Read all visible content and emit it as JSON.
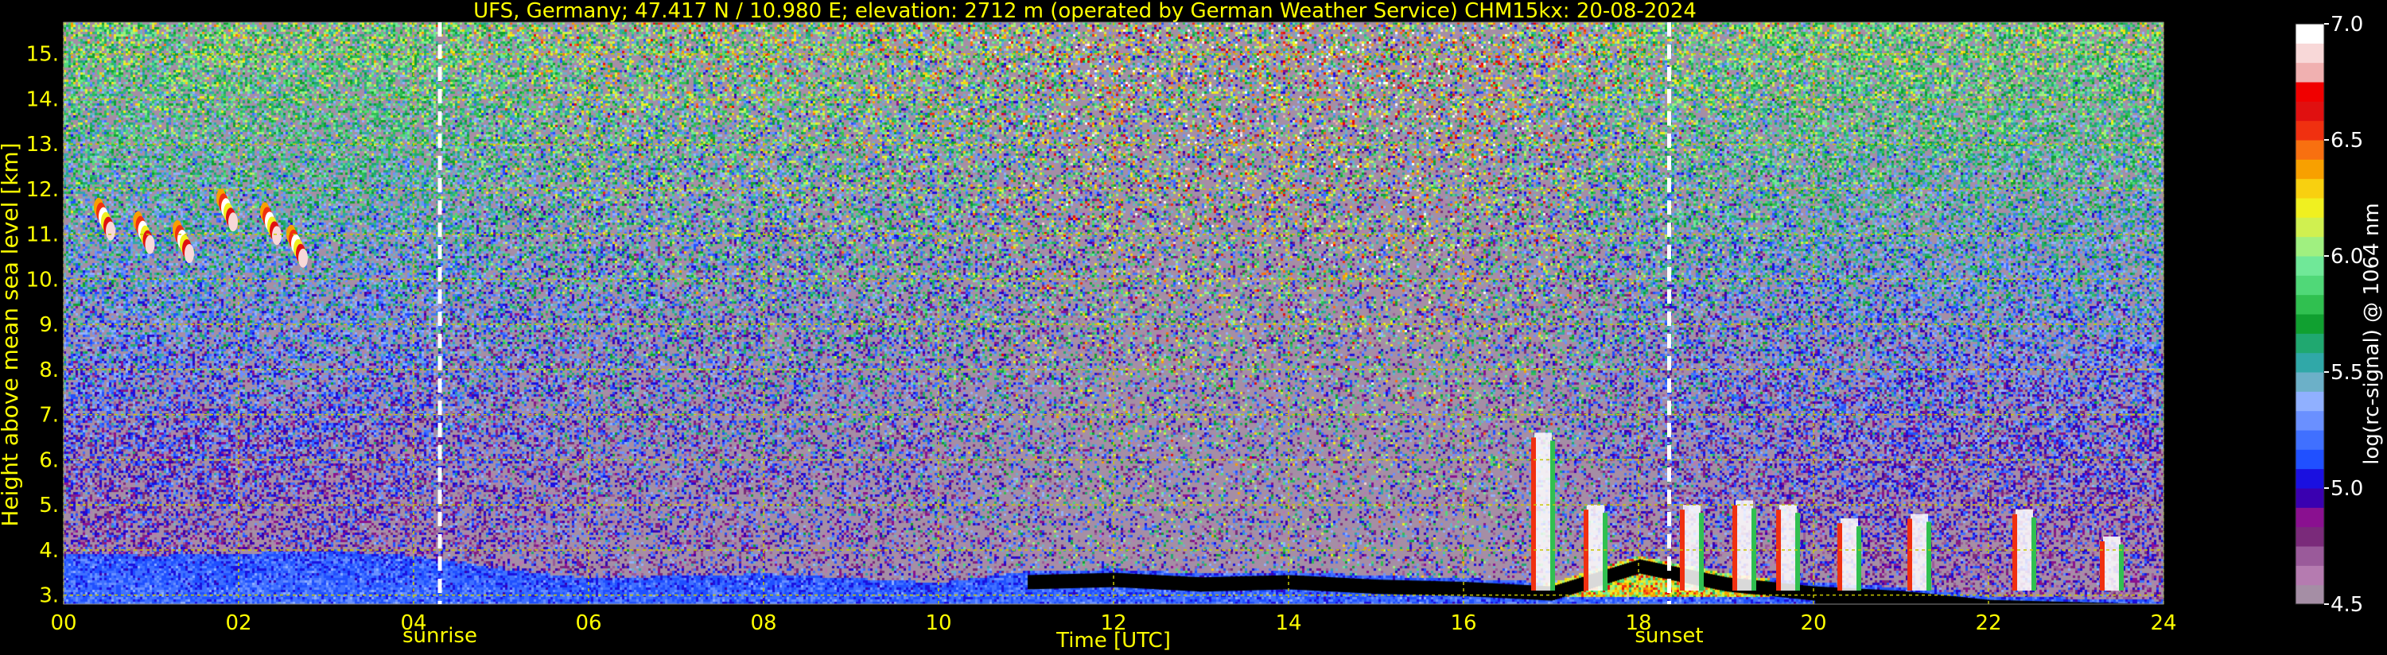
{
  "chart_data": {
    "type": "heatmap",
    "title": "UFS, Germany; 47.417 N / 10.980 E; elevation: 2712 m  (operated by German Weather Service)    CHM15kx: 20-08-2024",
    "xlabel": "Time [UTC]",
    "ylabel": "Height above mean sea level [km]",
    "xlim": [
      0,
      24
    ],
    "ylim": [
      2.8,
      15.7
    ],
    "x_ticks": [
      0,
      2,
      4,
      6,
      8,
      10,
      12,
      14,
      16,
      18,
      20,
      22,
      24
    ],
    "x_tick_labels": [
      "00",
      "02",
      "04",
      "06",
      "08",
      "10",
      "12",
      "14",
      "16",
      "18",
      "20",
      "22",
      "24"
    ],
    "y_ticks": [
      3,
      4,
      5,
      6,
      7,
      8,
      9,
      10,
      11,
      12,
      13,
      14,
      15
    ],
    "y_tick_labels": [
      "3.",
      "4.",
      "5.",
      "6.",
      "7.",
      "8.",
      "9.",
      "10.",
      "11.",
      "12.",
      "13.",
      "14.",
      "15."
    ],
    "grid": true,
    "colorbar": {
      "label": "log(rc-signal) @ 1064 nm",
      "range": [
        4.5,
        7.0
      ],
      "ticks": [
        4.5,
        5.0,
        5.5,
        6.0,
        6.5,
        7.0
      ],
      "tick_labels": [
        "4.5",
        "5.0",
        "5.5",
        "6.0",
        "6.5",
        "7.0"
      ],
      "colors": [
        "#a58ea5",
        "#b57bb0",
        "#9a5a9a",
        "#7a2a7a",
        "#8a1090",
        "#3a00b0",
        "#1a10e0",
        "#2050ff",
        "#4070ff",
        "#6a90ff",
        "#90b0ff",
        "#6cb0c8",
        "#30a8a8",
        "#20a870",
        "#10a030",
        "#30c050",
        "#50d878",
        "#70e898",
        "#a0f080",
        "#d0f050",
        "#f0f020",
        "#f8d010",
        "#f8a000",
        "#f87010",
        "#f03010",
        "#e01010",
        "#f00000",
        "#f0b0b0",
        "#f8d8d8",
        "#ffffff"
      ]
    },
    "events": [
      {
        "name": "sunrise",
        "x": 4.3
      },
      {
        "name": "sunset",
        "x": 18.35
      }
    ],
    "features": {
      "boundary_layer": [
        [
          0,
          3.95
        ],
        [
          1,
          3.9
        ],
        [
          2,
          3.95
        ],
        [
          3,
          4.0
        ],
        [
          4,
          3.9
        ],
        [
          5,
          3.6
        ],
        [
          6,
          3.4
        ],
        [
          7,
          3.45
        ],
        [
          8,
          3.5
        ],
        [
          9,
          3.4
        ],
        [
          10,
          3.3
        ],
        [
          11,
          3.55
        ],
        [
          12,
          3.6
        ],
        [
          13,
          3.5
        ],
        [
          14,
          3.55
        ],
        [
          15,
          3.45
        ],
        [
          16,
          3.4
        ],
        [
          17,
          3.3
        ],
        [
          17.5,
          3.6
        ],
        [
          18,
          3.9
        ],
        [
          19,
          3.5
        ],
        [
          20,
          3.3
        ],
        [
          21,
          3.2
        ],
        [
          22,
          3.0
        ],
        [
          23,
          2.95
        ],
        [
          24,
          2.9
        ]
      ],
      "cirrus_clouds": [
        [
          0.4,
          11.6
        ],
        [
          0.85,
          11.3
        ],
        [
          1.3,
          11.1
        ],
        [
          1.8,
          11.8
        ],
        [
          2.3,
          11.5
        ],
        [
          2.6,
          11.0
        ]
      ],
      "convective_plumes": [
        [
          16.9,
          6.6
        ],
        [
          17.5,
          5.0
        ],
        [
          18.6,
          5.0
        ],
        [
          19.2,
          5.1
        ],
        [
          19.7,
          5.0
        ],
        [
          20.4,
          4.7
        ],
        [
          21.2,
          4.8
        ],
        [
          22.4,
          4.9
        ],
        [
          23.4,
          4.3
        ]
      ],
      "noise_scale": [
        [
          0,
          0.55
        ],
        [
          2,
          0.55
        ],
        [
          4,
          0.55
        ],
        [
          6,
          0.8
        ],
        [
          8,
          0.85
        ],
        [
          10,
          0.95
        ],
        [
          12,
          1.4
        ],
        [
          14,
          1.4
        ],
        [
          15.5,
          1.5
        ],
        [
          17,
          1.2
        ],
        [
          18,
          0.75
        ],
        [
          20,
          0.6
        ],
        [
          22,
          0.55
        ],
        [
          24,
          0.55
        ]
      ]
    }
  }
}
